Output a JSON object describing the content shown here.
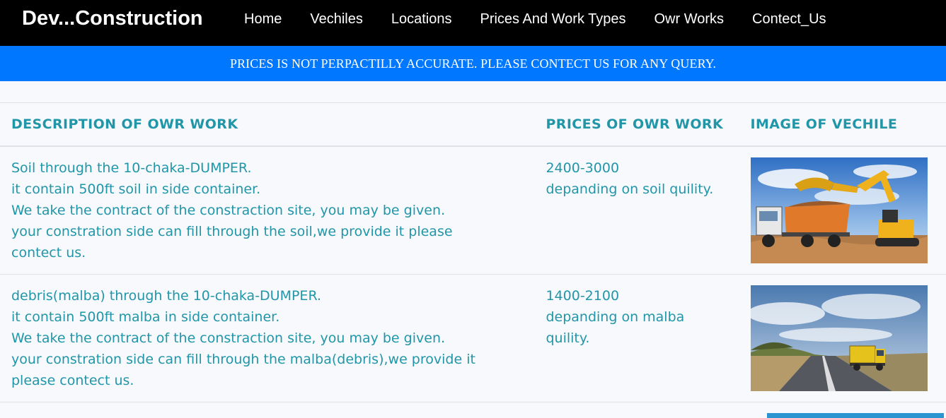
{
  "navbar": {
    "brand": "Dev...Construction",
    "links": [
      "Home",
      "Vechiles",
      "Locations",
      "Prices And Work Types",
      "Owr Works",
      "Contect_Us"
    ]
  },
  "notice": "PRICES IS NOT PERPACTILLY ACCURATE. PLEASE CONTECT US FOR ANY QUERY.",
  "table": {
    "headers": [
      "DESCRIPTION OF OWR WORK",
      "PRICES OF OWR WORK",
      "IMAGE OF VECHILE"
    ],
    "rows": [
      {
        "description": [
          "Soil through the 10-chaka-DUMPER.",
          "it contain 500ft soil in side container.",
          "We take the contract of the constraction site, you may be given.",
          "your constration side can fill through the soil,we provide it please contect us."
        ],
        "price": [
          "2400-3000",
          "depanding on soil quility."
        ],
        "image_icon": "excavator-loading-dumper-image"
      },
      {
        "description": [
          "debris(malba) through the 10-chaka-DUMPER.",
          "it contain 500ft malba in side container.",
          "We take the contract of the constraction site, you may be given.",
          "your constration side can fill through the malba(debris),we provide it please contect us."
        ],
        "price": [
          "1400-2100",
          "depanding on malba quility."
        ],
        "image_icon": "dumper-on-road-image"
      }
    ]
  },
  "colors": {
    "navbar_bg": "#000000",
    "notice_bg": "#0077ff",
    "table_text": "#2196a8",
    "page_bg": "#f7f9fd"
  }
}
